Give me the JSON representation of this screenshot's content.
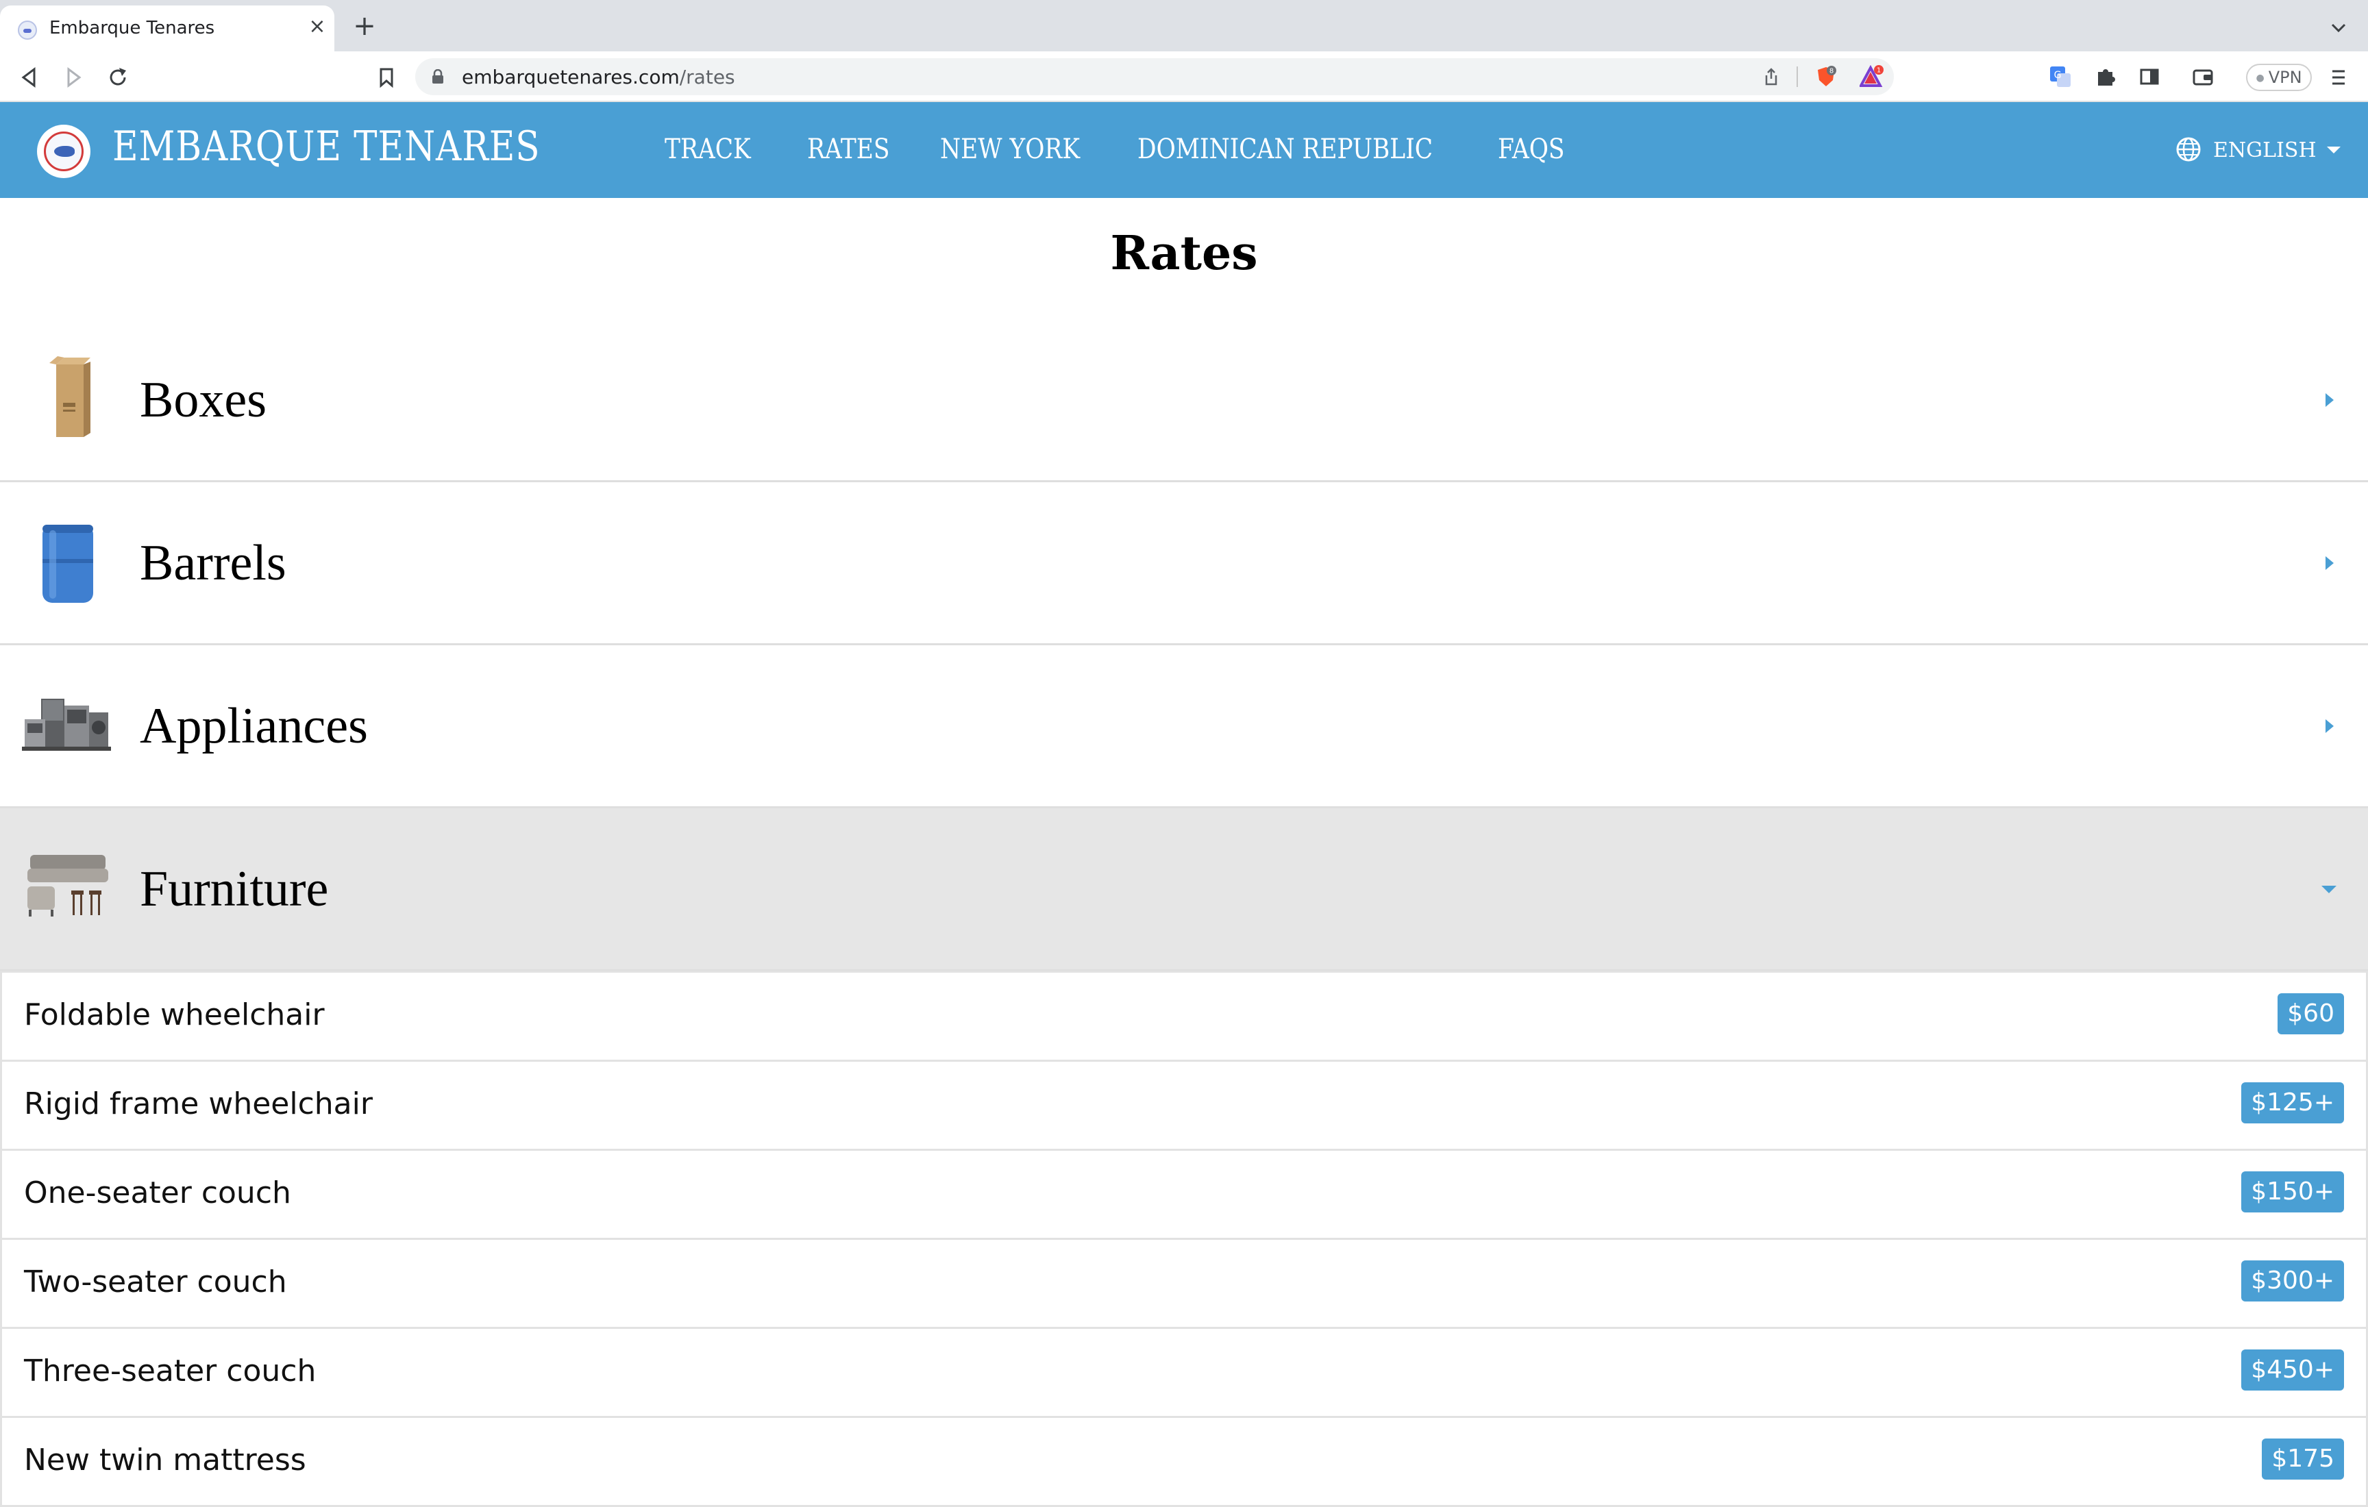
{
  "browser": {
    "tab_title": "Embarque Tenares",
    "url_host": "embarquetenares.com",
    "url_path": "/rates",
    "shield_count": "8",
    "rewards_count": "1",
    "vpn_label": "VPN"
  },
  "site": {
    "brand": "EMBARQUE TENARES",
    "nav": [
      "TRACK",
      "RATES",
      "NEW YORK",
      "DOMINICAN REPUBLIC",
      "FAQS"
    ],
    "language": "ENGLISH",
    "accent_color": "#4a9fd4"
  },
  "page": {
    "title": "Rates",
    "categories": [
      {
        "label": "Boxes",
        "icon": "box-icon",
        "expanded": false
      },
      {
        "label": "Barrels",
        "icon": "barrel-icon",
        "expanded": false
      },
      {
        "label": "Appliances",
        "icon": "appliances-icon",
        "expanded": false
      },
      {
        "label": "Furniture",
        "icon": "furniture-icon",
        "expanded": true
      }
    ],
    "furniture_rates": [
      {
        "name": "Foldable wheelchair",
        "price": "$60"
      },
      {
        "name": "Rigid frame wheelchair",
        "price": "$125+"
      },
      {
        "name": "One-seater couch",
        "price": "$150+"
      },
      {
        "name": "Two-seater couch",
        "price": "$300+"
      },
      {
        "name": "Three-seater couch",
        "price": "$450+"
      },
      {
        "name": "New twin mattress",
        "price": "$175"
      }
    ]
  }
}
